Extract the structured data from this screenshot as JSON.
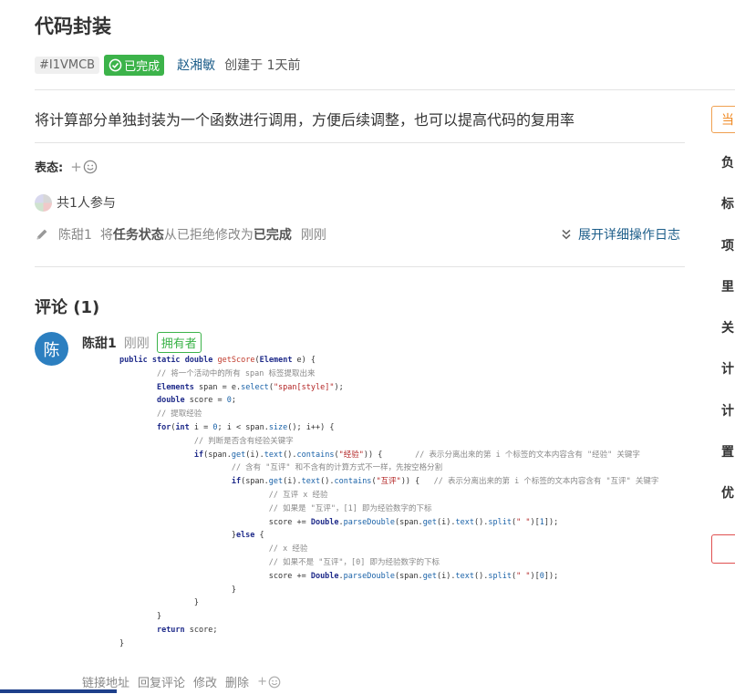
{
  "task": {
    "title": "代码封装",
    "id": "#I1VMCB",
    "status": "已完成",
    "author": "赵湘敏",
    "created": "创建于 1天前",
    "description": "将计算部分单独封装为一个函数进行调用，方便后续调整，也可以提高代码的复用率"
  },
  "reactions": {
    "label": "表态:",
    "add": "+"
  },
  "participants": {
    "text": "共1人参与"
  },
  "activity": {
    "user": "陈甜1",
    "action_prefix": "将",
    "field": "任务状态",
    "from_text": "从已拒绝修改为",
    "to": "已完成",
    "time": "刚刚",
    "expand_label": "展开详细操作日志"
  },
  "comments": {
    "title": "评论 (1)",
    "items": [
      {
        "avatar_char": "陈",
        "name": "陈甜1",
        "time": "刚刚",
        "badge": "拥有者",
        "code_lines": [
          "public static double getScore(Element e) {",
          "        // 将一个活动中的所有 span 标签提取出来",
          "        Elements span = e.select(\"span[style]\");",
          "        double score = 0;",
          "        // 提取经验",
          "        for(int i = 0; i < span.size(); i++) {",
          "                // 判断是否含有经验关键字",
          "                if(span.get(i).text().contains(\"经验\")) {       // 表示分离出来的第 i 个标签的文本内容含有 \"经验\" 关键字",
          "                        // 含有 \"互评\" 和不含有的计算方式不一样，先按空格分割",
          "                        if(span.get(i).text().contains(\"互评\")) {   // 表示分离出来的第 i 个标签的文本内容含有 \"互评\" 关键字",
          "                                // 互评 x 经验",
          "                                // 如果是 \"互评\"，[1] 即为经验数字的下标",
          "                                score += Double.parseDouble(span.get(i).text().split(\" \")[1]);",
          "                        }else {",
          "                                // x 经验",
          "                                // 如果不是 \"互评\"，[0] 即为经验数字的下标",
          "                                score += Double.parseDouble(span.get(i).text().split(\" \")[0]);",
          "                        }",
          "                }",
          "        }",
          "        return score;",
          "}"
        ],
        "actions": [
          "链接地址",
          "回复评论",
          "修改",
          "删除"
        ],
        "react_add": "+"
      }
    ]
  },
  "sidebar": {
    "button_partial": "当",
    "items": [
      "负",
      "标",
      "项",
      "里",
      "关",
      "计",
      "计",
      "置",
      "优"
    ]
  },
  "colors": {
    "accent_green": "#3cb34a",
    "link_blue": "#1d5e8a",
    "avatar_blue": "#2c7fc0",
    "sidebar_orange": "#f08a24"
  }
}
